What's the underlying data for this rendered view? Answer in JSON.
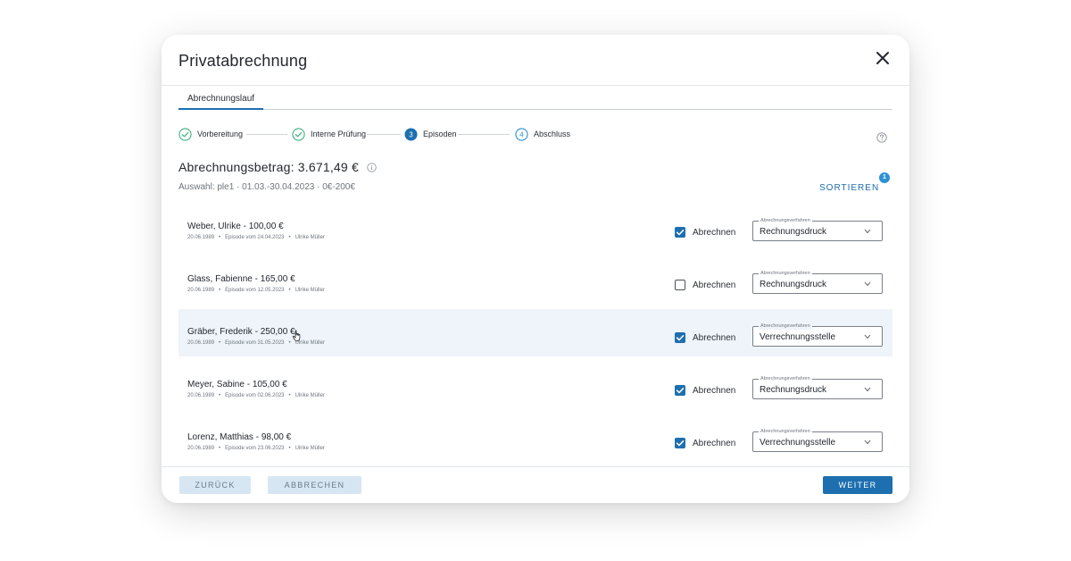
{
  "dialog": {
    "title": "Privatabrechnung",
    "close_icon": "close-icon"
  },
  "tabs": [
    {
      "label": "Abrechnungslauf",
      "active": true
    }
  ],
  "stepper": {
    "steps": [
      {
        "label": "Vorbereitung",
        "state": "done",
        "icon": "check-circle-icon"
      },
      {
        "label": "Interne Prüfung",
        "state": "done",
        "icon": "check-circle-icon"
      },
      {
        "label": "Episoden",
        "state": "active",
        "number": "3"
      },
      {
        "label": "Abschluss",
        "state": "pending",
        "number": "4"
      }
    ]
  },
  "summary": {
    "amount_label": "Abrechnungsbetrag: 3.671,49 €",
    "selection": "Auswahl: ple1 · 01.03.-30.04.2023 · 0€-200€",
    "sort_label": "SORTIEREN",
    "sort_badge": "1"
  },
  "rows": [
    {
      "title": "Weber, Ulrike - 100,00 €",
      "birth": "20.06.1989",
      "episode": "Episode vom 24.04.2023",
      "doctor": "Ulrike Müller",
      "checked": true,
      "check_label": "Abrechnen",
      "select_legend": "Abrechnungsverfahren",
      "select_value": "Rechnungsdruck",
      "highlight": false
    },
    {
      "title": "Glass, Fabienne - 165,00 €",
      "birth": "20.06.1989",
      "episode": "Episode vom 12.05.2023",
      "doctor": "Ulrike Müller",
      "checked": false,
      "check_label": "Abrechnen",
      "select_legend": "Abrechnungsverfahren",
      "select_value": "Rechnungsdruck",
      "highlight": false
    },
    {
      "title": "Gräber, Frederik - 250,00 €",
      "birth": "20.06.1989",
      "episode": "Episode vom 31.05.2023",
      "doctor": "Ulrike Müller",
      "checked": true,
      "check_label": "Abrechnen",
      "select_legend": "Abrechnungsverfahren",
      "select_value": "Verrechnungsstelle",
      "highlight": true
    },
    {
      "title": "Meyer, Sabine - 105,00 €",
      "birth": "20.06.1989",
      "episode": "Episode vom 02.06.2023",
      "doctor": "Ulrike Müller",
      "checked": true,
      "check_label": "Abrechnen",
      "select_legend": "Abrechnungsverfahren",
      "select_value": "Rechnungsdruck",
      "highlight": false
    },
    {
      "title": "Lorenz, Matthias - 98,00 €",
      "birth": "20.06.1989",
      "episode": "Episode vom 23.06.2023",
      "doctor": "Ulrike Müller",
      "checked": true,
      "check_label": "Abrechnen",
      "select_legend": "Abrechnungsverfahren",
      "select_value": "Verrechnungsstelle",
      "highlight": false
    }
  ],
  "footer": {
    "back_label": "ZURÜCK",
    "cancel_label": "ABBRECHEN",
    "next_label": "WEITER"
  },
  "colors": {
    "primary": "#1d6fb0",
    "success": "#3fb37f",
    "badge": "#2a93d5",
    "row_highlight": "#eef4fa",
    "secondary_button": "#d7e6f3"
  }
}
